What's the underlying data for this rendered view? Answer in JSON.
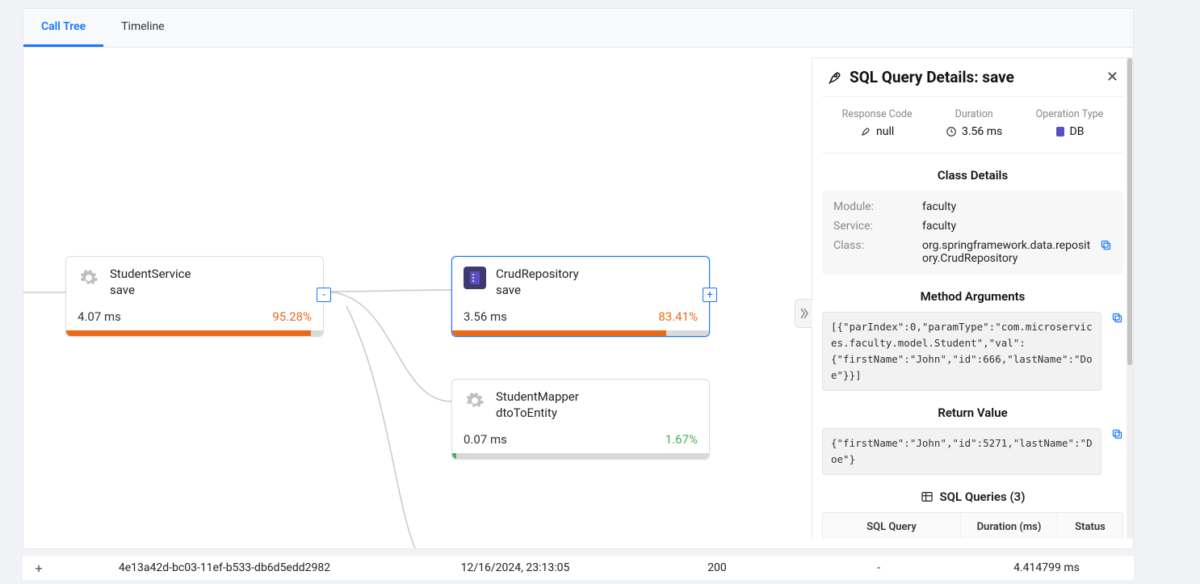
{
  "tabs": {
    "call_tree": "Call Tree",
    "timeline": "Timeline"
  },
  "nodes": {
    "student_service": {
      "title": "StudentService",
      "method": "save",
      "duration": "4.07  ms",
      "pct": "95.28%",
      "toggle": "-"
    },
    "crud_repo": {
      "title": "CrudRepository",
      "method": "save",
      "duration": "3.56  ms",
      "pct": "83.41%",
      "toggle": "+"
    },
    "student_mapper": {
      "title": "StudentMapper",
      "method": "dtoToEntity",
      "duration": "0.07  ms",
      "pct": "1.67%"
    }
  },
  "panel": {
    "title": "SQL Query Details: save",
    "summary": {
      "response_code_label": "Response Code",
      "response_code_value": "null",
      "duration_label": "Duration",
      "duration_value": "3.56 ms",
      "op_type_label": "Operation Type",
      "op_type_value": "DB"
    },
    "class_details": {
      "heading": "Class Details",
      "module_label": "Module:",
      "module_value": "faculty",
      "service_label": "Service:",
      "service_value": "faculty",
      "class_label": "Class:",
      "class_value": "org.springframework.data.repository.CrudRepository"
    },
    "method_args": {
      "heading": "Method Arguments",
      "code": "[{\"parIndex\":0,\"paramType\":\"com.microservices.faculty.model.Student\",\"val\":{\"firstName\":\"John\",\"id\":666,\"lastName\":\"Doe\"}}]"
    },
    "return_value": {
      "heading": "Return Value",
      "code": "{\"firstName\":\"John\",\"id\":5271,\"lastName\":\"Doe\"}"
    },
    "sql": {
      "heading": "SQL Queries (3)",
      "col_query": "SQL Query",
      "col_duration": "Duration (ms)",
      "col_status": "Status"
    }
  },
  "bottom": {
    "trace_id": "4e13a42d-bc03-11ef-b533-db6d5edd2982",
    "timestamp": "12/16/2024, 23:13:05",
    "status_code": "200",
    "dash": "-",
    "total_duration": "4.414799 ms"
  }
}
